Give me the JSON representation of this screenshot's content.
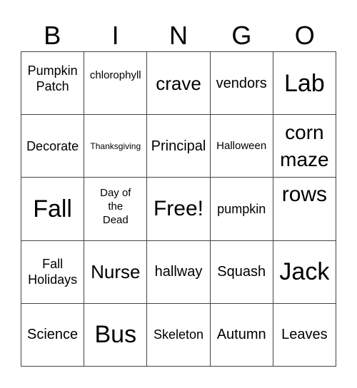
{
  "header": {
    "letters": [
      "B",
      "I",
      "N",
      "G",
      "O"
    ]
  },
  "card": {
    "rows": [
      [
        "Pumpkin Patch",
        "chlorophyll",
        "crave",
        "vendors",
        "Lab"
      ],
      [
        "Decorate",
        "Thanksgiving",
        "Principal",
        "Halloween",
        "corn maze"
      ],
      [
        "Fall",
        "Day of the Dead",
        "Free!",
        "pumpkin",
        "rows"
      ],
      [
        "Fall Holidays",
        "Nurse",
        "hallway",
        "Squash",
        "Jack"
      ],
      [
        "Science",
        "Bus",
        "Skeleton",
        "Autumn",
        "Leaves"
      ]
    ],
    "free_space": "Free!"
  }
}
